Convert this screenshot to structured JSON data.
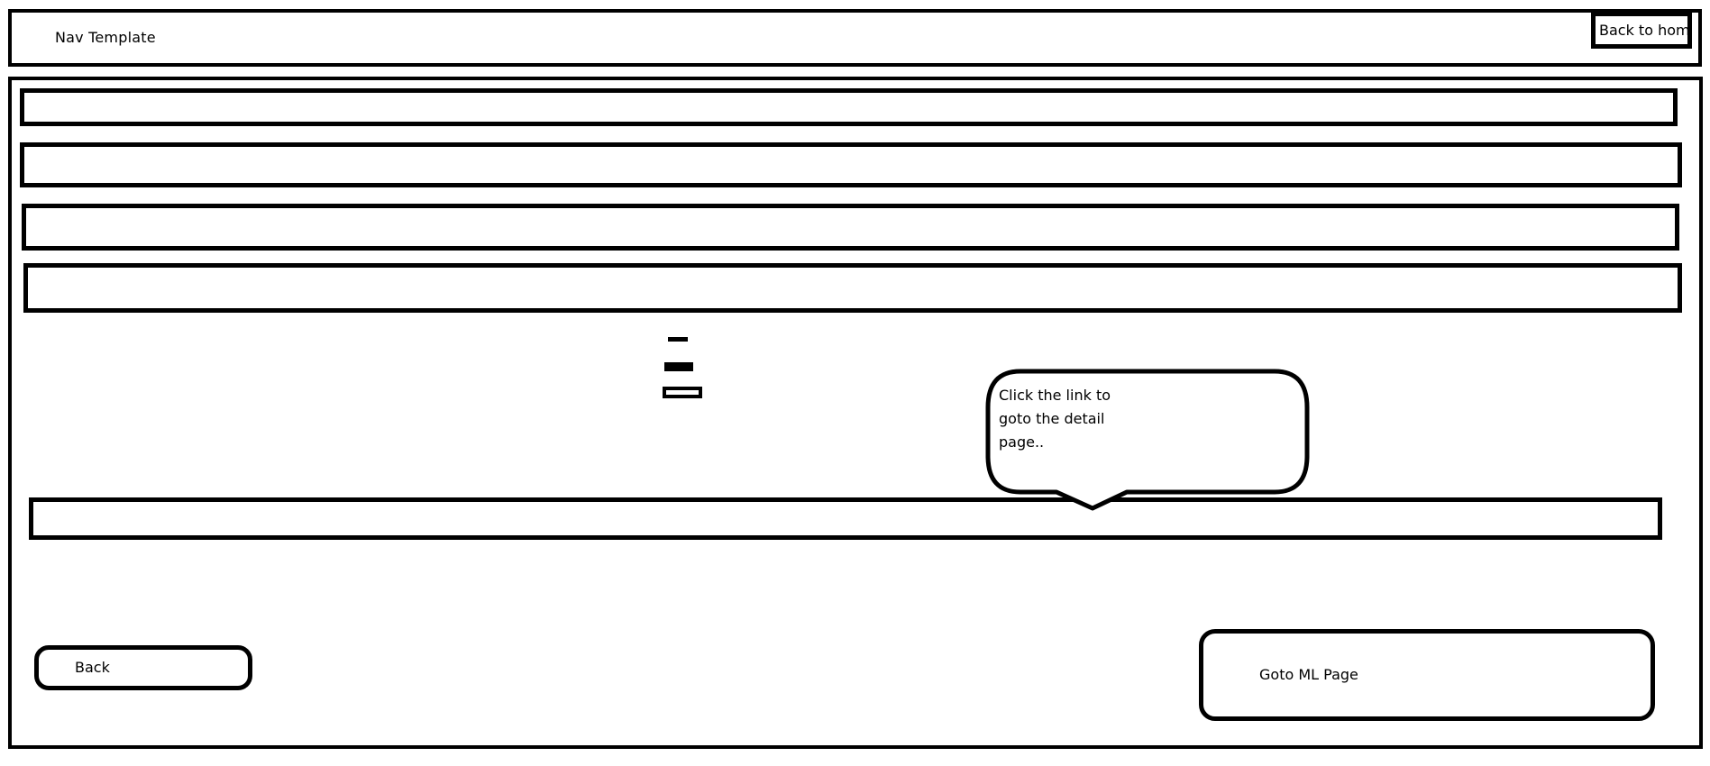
{
  "nav": {
    "title": "Nav Template",
    "back_home_label": "Back to home"
  },
  "callout": {
    "lines": [
      "Click the link to",
      "goto the detail",
      "page.."
    ]
  },
  "footer": {
    "back_label": "Back",
    "ml_page_label": "Goto ML Page"
  }
}
